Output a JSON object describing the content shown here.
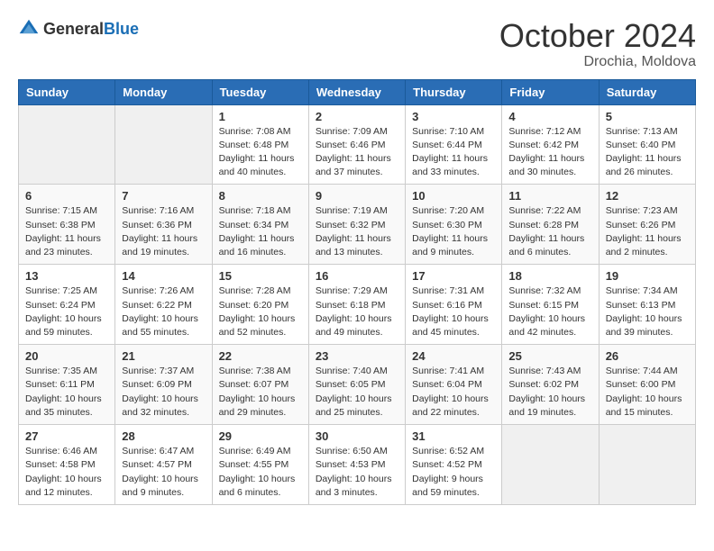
{
  "logo": {
    "general": "General",
    "blue": "Blue"
  },
  "title": "October 2024",
  "location": "Drochia, Moldova",
  "weekdays": [
    "Sunday",
    "Monday",
    "Tuesday",
    "Wednesday",
    "Thursday",
    "Friday",
    "Saturday"
  ],
  "weeks": [
    [
      {
        "day": "",
        "info": ""
      },
      {
        "day": "",
        "info": ""
      },
      {
        "day": "1",
        "info": "Sunrise: 7:08 AM\nSunset: 6:48 PM\nDaylight: 11 hours and 40 minutes."
      },
      {
        "day": "2",
        "info": "Sunrise: 7:09 AM\nSunset: 6:46 PM\nDaylight: 11 hours and 37 minutes."
      },
      {
        "day": "3",
        "info": "Sunrise: 7:10 AM\nSunset: 6:44 PM\nDaylight: 11 hours and 33 minutes."
      },
      {
        "day": "4",
        "info": "Sunrise: 7:12 AM\nSunset: 6:42 PM\nDaylight: 11 hours and 30 minutes."
      },
      {
        "day": "5",
        "info": "Sunrise: 7:13 AM\nSunset: 6:40 PM\nDaylight: 11 hours and 26 minutes."
      }
    ],
    [
      {
        "day": "6",
        "info": "Sunrise: 7:15 AM\nSunset: 6:38 PM\nDaylight: 11 hours and 23 minutes."
      },
      {
        "day": "7",
        "info": "Sunrise: 7:16 AM\nSunset: 6:36 PM\nDaylight: 11 hours and 19 minutes."
      },
      {
        "day": "8",
        "info": "Sunrise: 7:18 AM\nSunset: 6:34 PM\nDaylight: 11 hours and 16 minutes."
      },
      {
        "day": "9",
        "info": "Sunrise: 7:19 AM\nSunset: 6:32 PM\nDaylight: 11 hours and 13 minutes."
      },
      {
        "day": "10",
        "info": "Sunrise: 7:20 AM\nSunset: 6:30 PM\nDaylight: 11 hours and 9 minutes."
      },
      {
        "day": "11",
        "info": "Sunrise: 7:22 AM\nSunset: 6:28 PM\nDaylight: 11 hours and 6 minutes."
      },
      {
        "day": "12",
        "info": "Sunrise: 7:23 AM\nSunset: 6:26 PM\nDaylight: 11 hours and 2 minutes."
      }
    ],
    [
      {
        "day": "13",
        "info": "Sunrise: 7:25 AM\nSunset: 6:24 PM\nDaylight: 10 hours and 59 minutes."
      },
      {
        "day": "14",
        "info": "Sunrise: 7:26 AM\nSunset: 6:22 PM\nDaylight: 10 hours and 55 minutes."
      },
      {
        "day": "15",
        "info": "Sunrise: 7:28 AM\nSunset: 6:20 PM\nDaylight: 10 hours and 52 minutes."
      },
      {
        "day": "16",
        "info": "Sunrise: 7:29 AM\nSunset: 6:18 PM\nDaylight: 10 hours and 49 minutes."
      },
      {
        "day": "17",
        "info": "Sunrise: 7:31 AM\nSunset: 6:16 PM\nDaylight: 10 hours and 45 minutes."
      },
      {
        "day": "18",
        "info": "Sunrise: 7:32 AM\nSunset: 6:15 PM\nDaylight: 10 hours and 42 minutes."
      },
      {
        "day": "19",
        "info": "Sunrise: 7:34 AM\nSunset: 6:13 PM\nDaylight: 10 hours and 39 minutes."
      }
    ],
    [
      {
        "day": "20",
        "info": "Sunrise: 7:35 AM\nSunset: 6:11 PM\nDaylight: 10 hours and 35 minutes."
      },
      {
        "day": "21",
        "info": "Sunrise: 7:37 AM\nSunset: 6:09 PM\nDaylight: 10 hours and 32 minutes."
      },
      {
        "day": "22",
        "info": "Sunrise: 7:38 AM\nSunset: 6:07 PM\nDaylight: 10 hours and 29 minutes."
      },
      {
        "day": "23",
        "info": "Sunrise: 7:40 AM\nSunset: 6:05 PM\nDaylight: 10 hours and 25 minutes."
      },
      {
        "day": "24",
        "info": "Sunrise: 7:41 AM\nSunset: 6:04 PM\nDaylight: 10 hours and 22 minutes."
      },
      {
        "day": "25",
        "info": "Sunrise: 7:43 AM\nSunset: 6:02 PM\nDaylight: 10 hours and 19 minutes."
      },
      {
        "day": "26",
        "info": "Sunrise: 7:44 AM\nSunset: 6:00 PM\nDaylight: 10 hours and 15 minutes."
      }
    ],
    [
      {
        "day": "27",
        "info": "Sunrise: 6:46 AM\nSunset: 4:58 PM\nDaylight: 10 hours and 12 minutes."
      },
      {
        "day": "28",
        "info": "Sunrise: 6:47 AM\nSunset: 4:57 PM\nDaylight: 10 hours and 9 minutes."
      },
      {
        "day": "29",
        "info": "Sunrise: 6:49 AM\nSunset: 4:55 PM\nDaylight: 10 hours and 6 minutes."
      },
      {
        "day": "30",
        "info": "Sunrise: 6:50 AM\nSunset: 4:53 PM\nDaylight: 10 hours and 3 minutes."
      },
      {
        "day": "31",
        "info": "Sunrise: 6:52 AM\nSunset: 4:52 PM\nDaylight: 9 hours and 59 minutes."
      },
      {
        "day": "",
        "info": ""
      },
      {
        "day": "",
        "info": ""
      }
    ]
  ]
}
